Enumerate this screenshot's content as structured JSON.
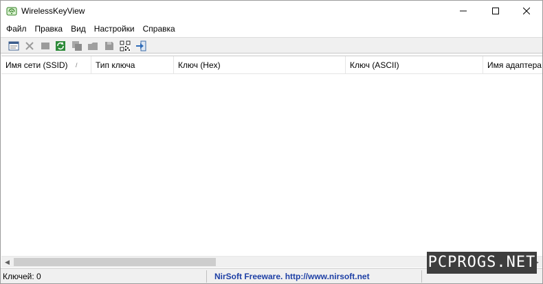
{
  "window": {
    "title": "WirelessKeyView",
    "icon": "wifi-key-app-icon",
    "controls": [
      "minimize-icon",
      "maximize-icon",
      "close-icon"
    ]
  },
  "menu": {
    "items": [
      "Файл",
      "Правка",
      "Вид",
      "Настройки",
      "Справка"
    ]
  },
  "toolbar": {
    "buttons": [
      "html-report-icon",
      "delete-icon",
      "copy-icon",
      "refresh-icon",
      "copy-keys-icon",
      "folder-icon",
      "save-icon",
      "qr-code-icon",
      "exit-icon"
    ]
  },
  "list": {
    "columns": [
      "Имя сети (SSID)",
      "Тип ключа",
      "Ключ (Hex)",
      "Ключ (ASCII)",
      "Имя адаптера"
    ],
    "sort_indicator": "/",
    "rows": []
  },
  "status": {
    "count_text": "Ключей: 0",
    "link_text": "NirSoft Freeware.  http://www.nirsoft.net"
  },
  "watermark": {
    "text": "PCPROGS.NET"
  },
  "colors": {
    "link": "#1d3fa5",
    "toolbar_bg": "#f0f0f0",
    "watermark_bg": "#3e3e3e"
  }
}
